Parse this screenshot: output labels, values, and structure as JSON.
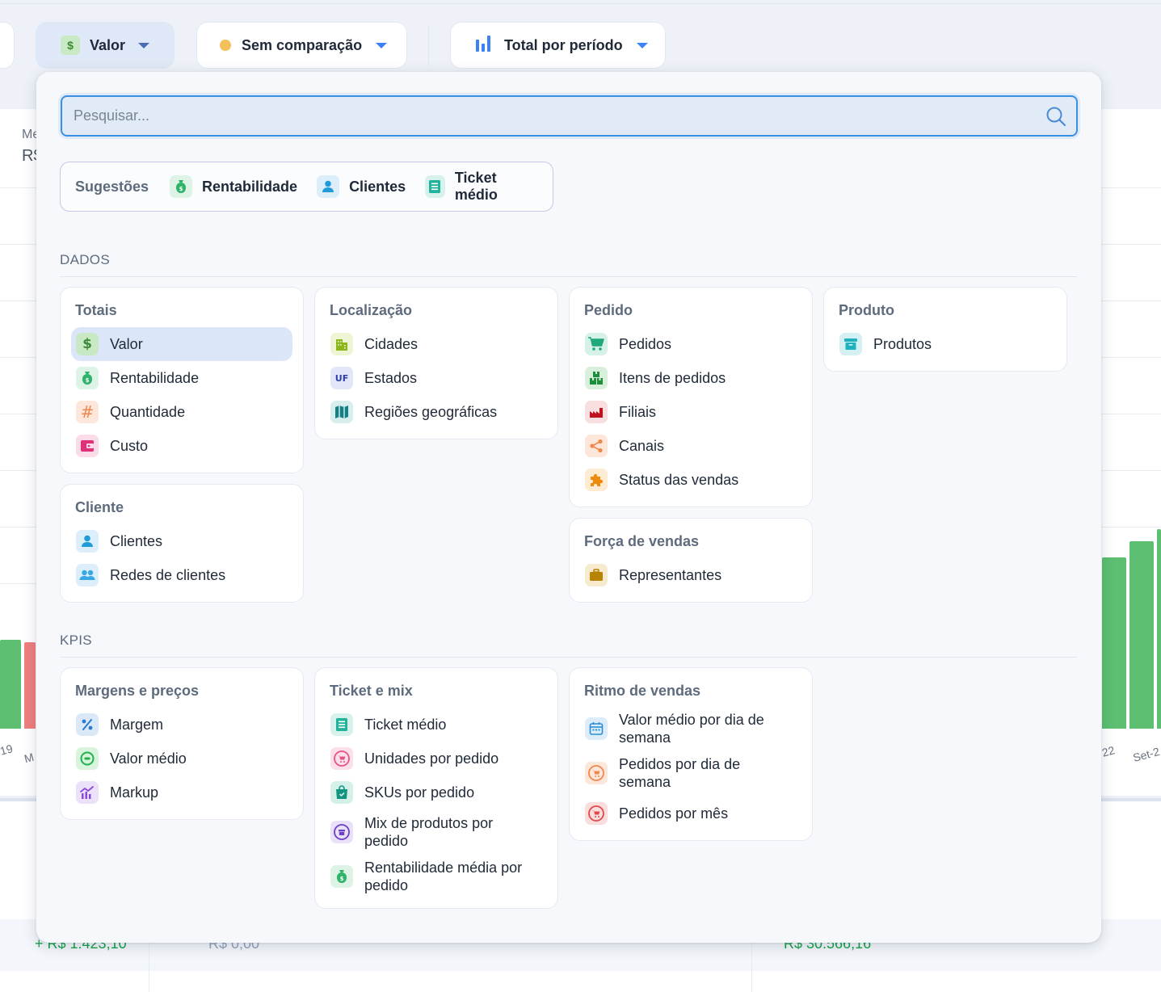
{
  "toolbar": {
    "metric_label": "Valor",
    "metric_icon": "dollar-icon",
    "comparison_label": "Sem comparação",
    "comparison_dot_color": "#f5c05a",
    "view_label": "Total por período",
    "view_icon": "bar-chart-icon"
  },
  "background": {
    "left_cut_label_1": "Me",
    "left_cut_label_2": "R$",
    "axis_left_1": "19",
    "axis_left_2": "M",
    "axis_right_1": "22",
    "axis_right_2": "Set-2",
    "values": [
      "+ R$ 1.423,10",
      "R$ 0,00",
      "R$ 30.566,16"
    ]
  },
  "dropdown": {
    "search_placeholder": "Pesquisar...",
    "suggestions_label": "Sugestões",
    "suggestions": [
      {
        "label": "Rentabilidade",
        "icon": "money-bag-icon"
      },
      {
        "label": "Clientes",
        "icon": "person-icon"
      },
      {
        "label": "Ticket médio",
        "icon": "receipt-icon"
      }
    ],
    "sections": [
      {
        "title": "DADOS",
        "cards": [
          {
            "title": "Totais",
            "items": [
              {
                "label": "Valor",
                "icon": "dollar-icon",
                "selected": true
              },
              {
                "label": "Rentabilidade",
                "icon": "money-bag-icon"
              },
              {
                "label": "Quantidade",
                "icon": "hash-icon"
              },
              {
                "label": "Custo",
                "icon": "wallet-icon"
              }
            ]
          },
          {
            "title": "Localização",
            "items": [
              {
                "label": "Cidades",
                "icon": "buildings-icon"
              },
              {
                "label": "Estados",
                "icon": "uf-icon"
              },
              {
                "label": "Regiões geográficas",
                "icon": "map-icon"
              }
            ]
          },
          {
            "title": "Pedido",
            "items": [
              {
                "label": "Pedidos",
                "icon": "cart-icon"
              },
              {
                "label": "Itens de pedidos",
                "icon": "boxes-icon"
              },
              {
                "label": "Filiais",
                "icon": "factory-icon"
              },
              {
                "label": "Canais",
                "icon": "share-icon"
              },
              {
                "label": "Status das vendas",
                "icon": "puzzle-icon"
              }
            ]
          },
          {
            "title": "Produto",
            "items": [
              {
                "label": "Produtos",
                "icon": "archive-box-icon"
              }
            ]
          },
          {
            "title": "Cliente",
            "items": [
              {
                "label": "Clientes",
                "icon": "person-icon"
              },
              {
                "label": "Redes de clientes",
                "icon": "people-icon"
              }
            ]
          },
          {
            "title": "Força de vendas",
            "items": [
              {
                "label": "Representantes",
                "icon": "briefcase-icon"
              }
            ]
          }
        ]
      },
      {
        "title": "KPIS",
        "cards": [
          {
            "title": "Margens e preços",
            "items": [
              {
                "label": "Margem",
                "icon": "percent-icon"
              },
              {
                "label": "Valor médio",
                "icon": "coin-icon"
              },
              {
                "label": "Markup",
                "icon": "trend-chart-icon"
              }
            ]
          },
          {
            "title": "Ticket e mix",
            "items": [
              {
                "label": "Ticket médio",
                "icon": "receipt-icon"
              },
              {
                "label": "Unidades por pedido",
                "icon": "cart-circle-icon"
              },
              {
                "label": "SKUs por pedido",
                "icon": "shopping-bag-icon"
              },
              {
                "label": "Mix de produtos por pedido",
                "icon": "box-circle-icon"
              },
              {
                "label": "Rentabilidade média por pedido",
                "icon": "money-bag-icon"
              }
            ]
          },
          {
            "title": "Ritmo de vendas",
            "items": [
              {
                "label": "Valor médio por dia de semana",
                "icon": "calendar-icon"
              },
              {
                "label": "Pedidos por dia de semana",
                "icon": "cart-circle-icon"
              },
              {
                "label": "Pedidos por mês",
                "icon": "cart-circle-icon"
              }
            ]
          }
        ]
      }
    ]
  },
  "colors": {
    "accent": "#3b8fe0",
    "selected_bg": "#dbe7f8",
    "chart_green": "#5cbf72",
    "chart_red": "#ef7f7f"
  }
}
